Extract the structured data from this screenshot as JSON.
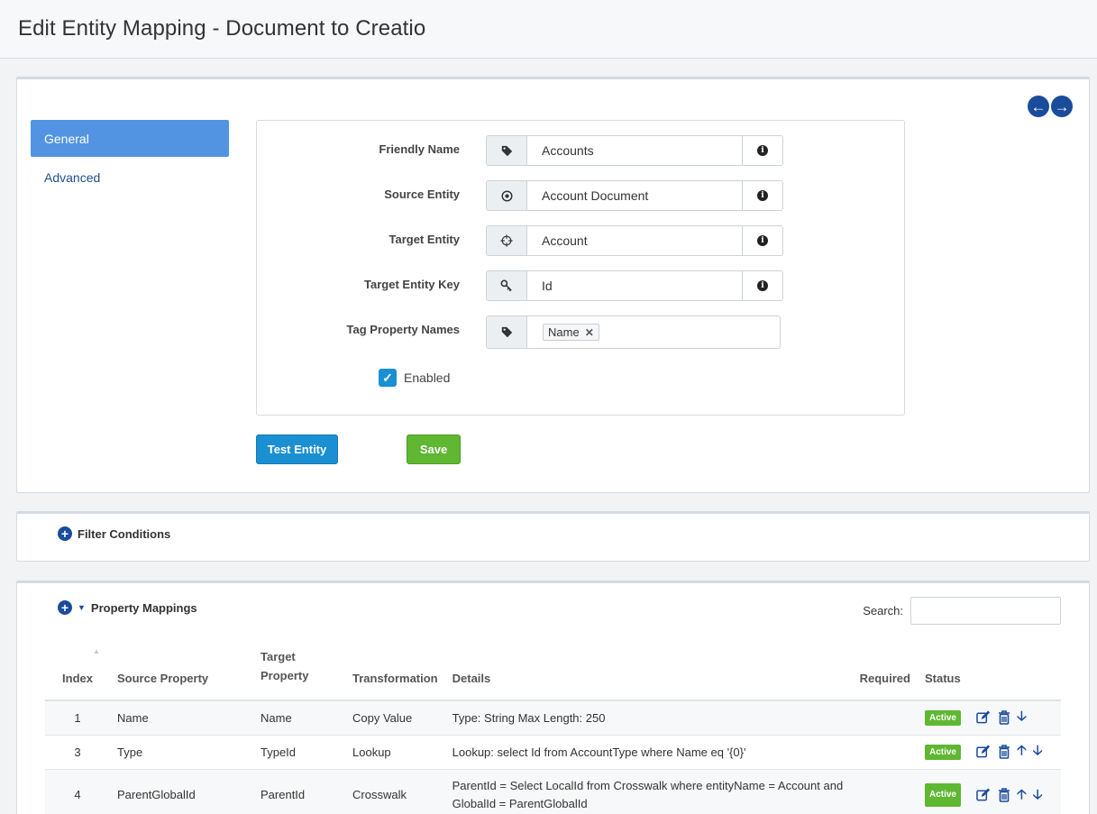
{
  "page": {
    "title": "Edit Entity Mapping - Document to Creatio"
  },
  "nav": {
    "back_icon": "arrow-left-circle-icon",
    "forward_icon": "arrow-right-circle-icon"
  },
  "tabs": [
    {
      "label": "General",
      "active": true
    },
    {
      "label": "Advanced",
      "active": false
    }
  ],
  "form": {
    "friendly_name": {
      "label": "Friendly Name",
      "value": "Accounts",
      "icon": "tag-icon"
    },
    "source_entity": {
      "label": "Source Entity",
      "value": "Account Document",
      "icon": "dot-circle-icon"
    },
    "target_entity": {
      "label": "Target Entity",
      "value": "Account",
      "icon": "crosshairs-icon"
    },
    "target_entity_key": {
      "label": "Target Entity Key",
      "value": "Id",
      "icon": "key-icon"
    },
    "tag_property_names": {
      "label": "Tag Property Names",
      "tags": [
        "Name"
      ],
      "icon": "tag-icon"
    },
    "enabled": {
      "label": "Enabled",
      "checked": true
    }
  },
  "buttons": {
    "test_entity": "Test Entity",
    "save": "Save"
  },
  "filter": {
    "title": "Filter Conditions"
  },
  "property_mappings": {
    "title": "Property Mappings",
    "search_label": "Search:",
    "search_value": "",
    "columns": [
      "Index",
      "Source Property",
      "Target Property",
      "Transformation",
      "Details",
      "Required",
      "Status"
    ],
    "rows": [
      {
        "index": "1",
        "source": "Name",
        "target": "Name",
        "transformation": "Copy Value",
        "details": "Type: String Max Length: 250",
        "required": "",
        "status": "Active"
      },
      {
        "index": "3",
        "source": "Type",
        "target": "TypeId",
        "transformation": "Lookup",
        "details": "Lookup: select Id from AccountType where Name eq '{0}'",
        "required": "",
        "status": "Active"
      },
      {
        "index": "4",
        "source": "ParentGlobalId",
        "target": "ParentId",
        "transformation": "Crosswalk",
        "details_line1": "ParentId = Select LocalId from Crosswalk where entityName = Account and",
        "details_line2": "GlobalId = ParentGlobalId",
        "required": "",
        "status": "Active"
      }
    ]
  },
  "colors": {
    "accent": "#1a4c9b",
    "tab_active": "#5294e2",
    "primary_button": "#1a8fd1",
    "success": "#5fb732"
  }
}
